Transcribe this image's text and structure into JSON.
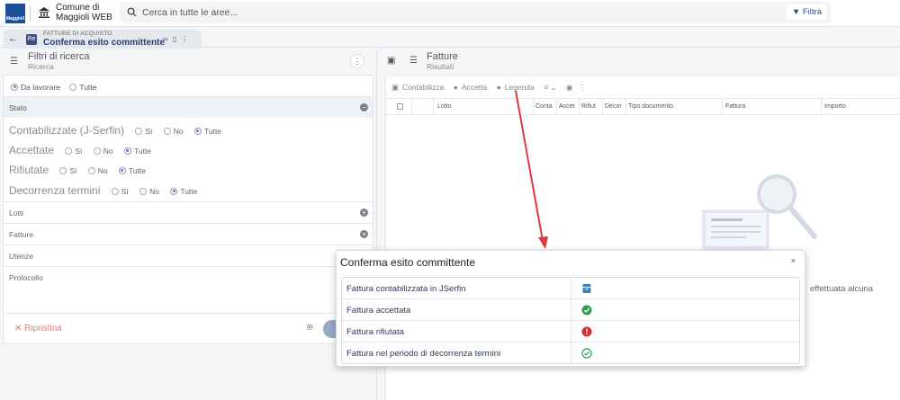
{
  "app": {
    "logo_text": "Maggioli",
    "name": "Comune di Maggioli WEB"
  },
  "search": {
    "placeholder": "Cerca in tutte le aree...",
    "filter_label": "Filtra"
  },
  "tab": {
    "section": "FATTURE DI ACQUISTO",
    "title": "Conferma esito committente",
    "icon_text": "Re"
  },
  "left_panel": {
    "title": "Filtri di ricerca",
    "subtitle": "Ricerca",
    "scope_options": [
      "Da lavorare",
      "Tutte"
    ],
    "sections": {
      "stato": "Stato",
      "lotti": "Lotti",
      "fatture": "Fatture",
      "utenze": "Utenze",
      "protocollo": "Protocollo"
    },
    "filters": [
      {
        "label": "Contabilizzate (J-Serfin)",
        "options": [
          "Sì",
          "No",
          "Tutte"
        ],
        "selected": "Tutte"
      },
      {
        "label": "Accettate",
        "options": [
          "Sì",
          "No",
          "Tutte"
        ],
        "selected": "Tutte"
      },
      {
        "label": "Rifiutate",
        "options": [
          "Sì",
          "No",
          "Tutte"
        ],
        "selected": "Tutte"
      },
      {
        "label": "Decorrenza termini",
        "options": [
          "Sì",
          "No",
          "Tutte"
        ],
        "selected": "Tutte"
      }
    ],
    "reset_label": "Ripristina"
  },
  "right_panel": {
    "title": "Fatture",
    "subtitle": "Risultati",
    "toolbar": {
      "contabilizza": "Contabilizza",
      "accetta": "Accetta",
      "legenda": "Legenda"
    },
    "columns": [
      "Lotto",
      "Conta",
      "Accet",
      "Rifiut",
      "Decor",
      "Tipo documento",
      "Fattura",
      "Importo"
    ],
    "empty_text": "effettuata alcuna"
  },
  "modal": {
    "title": "Conferma esito committente",
    "close": "×",
    "rows": [
      {
        "label": "Fattura contabilizzata in JSerfin",
        "icon": "archive-icon"
      },
      {
        "label": "Fattura accettata",
        "icon": "check-circle-icon"
      },
      {
        "label": "Fattura rifiutata",
        "icon": "error-circle-icon"
      },
      {
        "label": "Fattura nel periodo di decorrenza termini",
        "icon": "check-circle-outline-icon"
      }
    ]
  },
  "colors": {
    "primary": "#2b3f7a",
    "accepted": "#2e9e4f",
    "rejected": "#d32f2f",
    "annotation": "#e0393b",
    "archive": "#3f7fb5"
  }
}
